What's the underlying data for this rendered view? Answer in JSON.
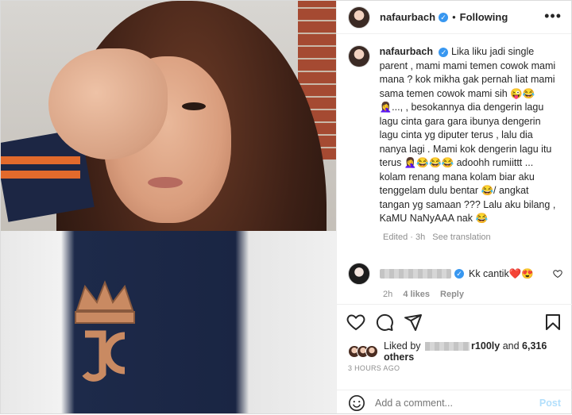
{
  "post": {
    "username": "nafaurbach",
    "separator": "•",
    "follow_status": "Following",
    "more_label": "•••"
  },
  "caption": {
    "username": "nafaurbach",
    "text": "Lika liku jadi single parent , mami mami temen cowok mami mana ? kok mikha gak pernah liat mami sama temen cowok mami sih 😜😂 🤦‍♀️..., , besokannya dia dengerin lagu lagu cinta gara gara ibunya dengerin lagu cinta yg diputer terus , lalu dia nanya lagi . Mami kok dengerin lagu itu terus 🤦‍♀️😂😂😂 adoohh rumiittt ... kolam renang mana kolam biar aku tenggelam dulu bentar 😂/ angkat tangan yg samaan ??? Lalu aku bilang , KaMU NaNyAAA nak 😂",
    "edited": "Edited · 3h",
    "see_translation": "See translation"
  },
  "comment": {
    "text": "Kk cantik❤️😍",
    "time": "2h",
    "likes": "4 likes",
    "reply": "Reply"
  },
  "likes": {
    "prefix": "Liked by",
    "partial_name": "r100ly",
    "connector": "and",
    "others": "6,316 others"
  },
  "timestamp": "3 HOURS AGO",
  "add_comment": {
    "placeholder": "Add a comment...",
    "post_label": "Post"
  },
  "colors": {
    "verified_blue": "#3897f0",
    "post_button": "#b2dffc",
    "heart_red": "#ed4956"
  },
  "icons": [
    "heart-icon",
    "comment-icon",
    "share-icon",
    "bookmark-icon",
    "emoji-icon",
    "verified-icon",
    "more-icon"
  ]
}
